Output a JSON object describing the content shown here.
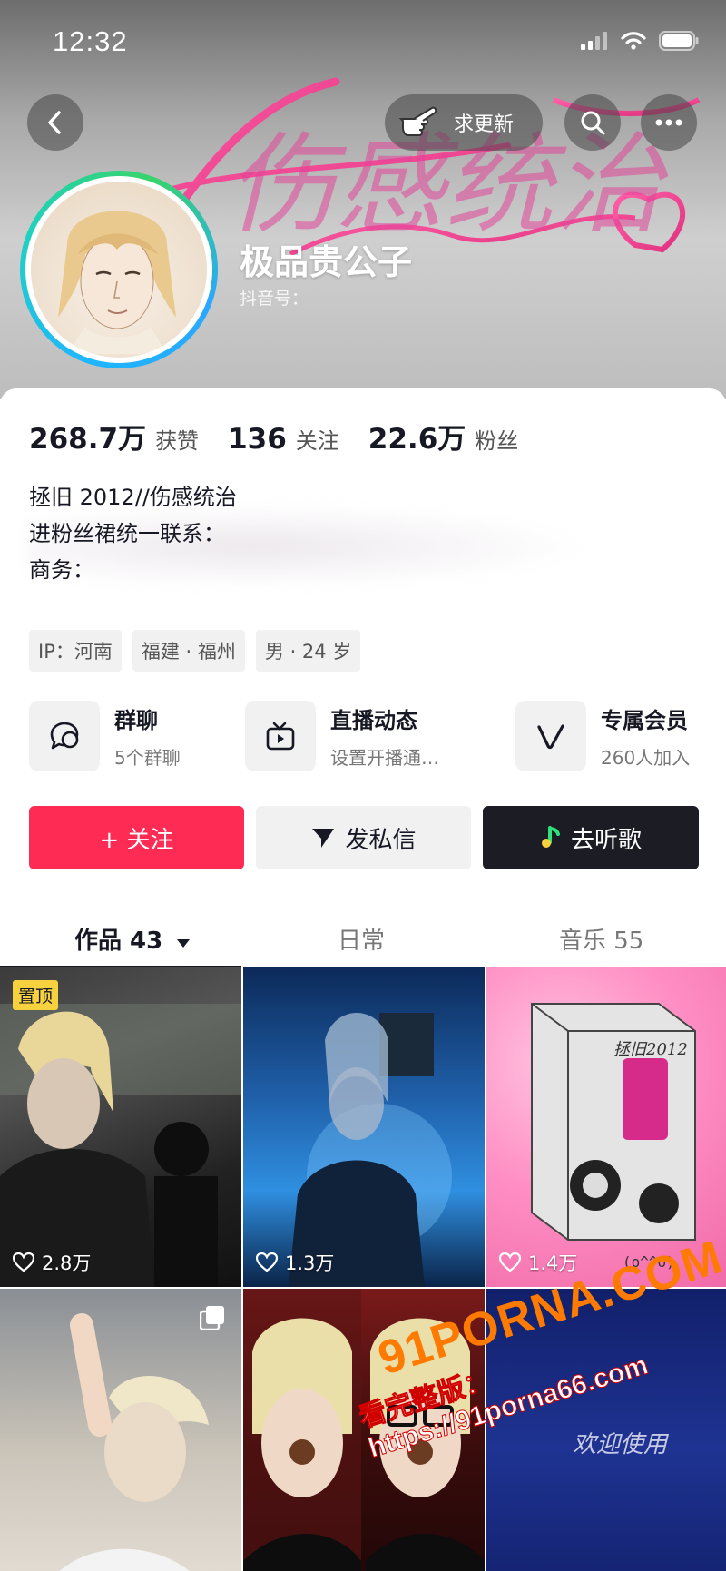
{
  "status_bar": {
    "time": "12:32"
  },
  "header": {
    "update_request_label": "求更新",
    "banner_text": "伤感统治",
    "username": "极品贵公子",
    "douyin_id_label": "抖音号：",
    "gradient_colors": [
      "#1fb6ff",
      "#38d46a"
    ]
  },
  "stats": [
    {
      "value": "268.7万",
      "label": "获赞"
    },
    {
      "value": "136",
      "label": "关注"
    },
    {
      "value": "22.6万",
      "label": "粉丝"
    }
  ],
  "bio": [
    "拯旧 2012//伤感统治",
    "进粉丝裙统一联系：",
    "商务："
  ],
  "tags": [
    "IP：河南",
    "福建 · 福州",
    "男 · 24 岁"
  ],
  "features": [
    {
      "title": "群聊",
      "subtitle": "5个群聊",
      "icon": "group-chat-icon"
    },
    {
      "title": "直播动态",
      "subtitle": "设置开播通…",
      "icon": "tv-icon"
    },
    {
      "title": "专属会员",
      "subtitle": "260人加入",
      "icon": "vip-icon"
    }
  ],
  "actions": {
    "follow": "+ 关注",
    "message": "发私信",
    "listen": "去听歌"
  },
  "tabs": [
    {
      "label": "作品 43",
      "active": true
    },
    {
      "label": "日常",
      "active": false
    },
    {
      "label": "音乐 55",
      "active": false
    }
  ],
  "videos": [
    {
      "likes": "2.8万",
      "pinned_label": "置顶"
    },
    {
      "likes": "1.3万"
    },
    {
      "likes": "1.4万",
      "album_title": "拯旧2012",
      "album_tag": "(o^^o)"
    },
    {
      "likes": ""
    },
    {
      "likes": ""
    },
    {
      "likes": "",
      "overlay_text": "欢迎使用"
    }
  ],
  "watermark": {
    "main": "91PORNA.COM",
    "sub": "看完整版：https://91porna66.com"
  },
  "colors": {
    "accent": "#fe2c55",
    "dark_button": "#1c1c24",
    "pin": "#f7d23e"
  }
}
